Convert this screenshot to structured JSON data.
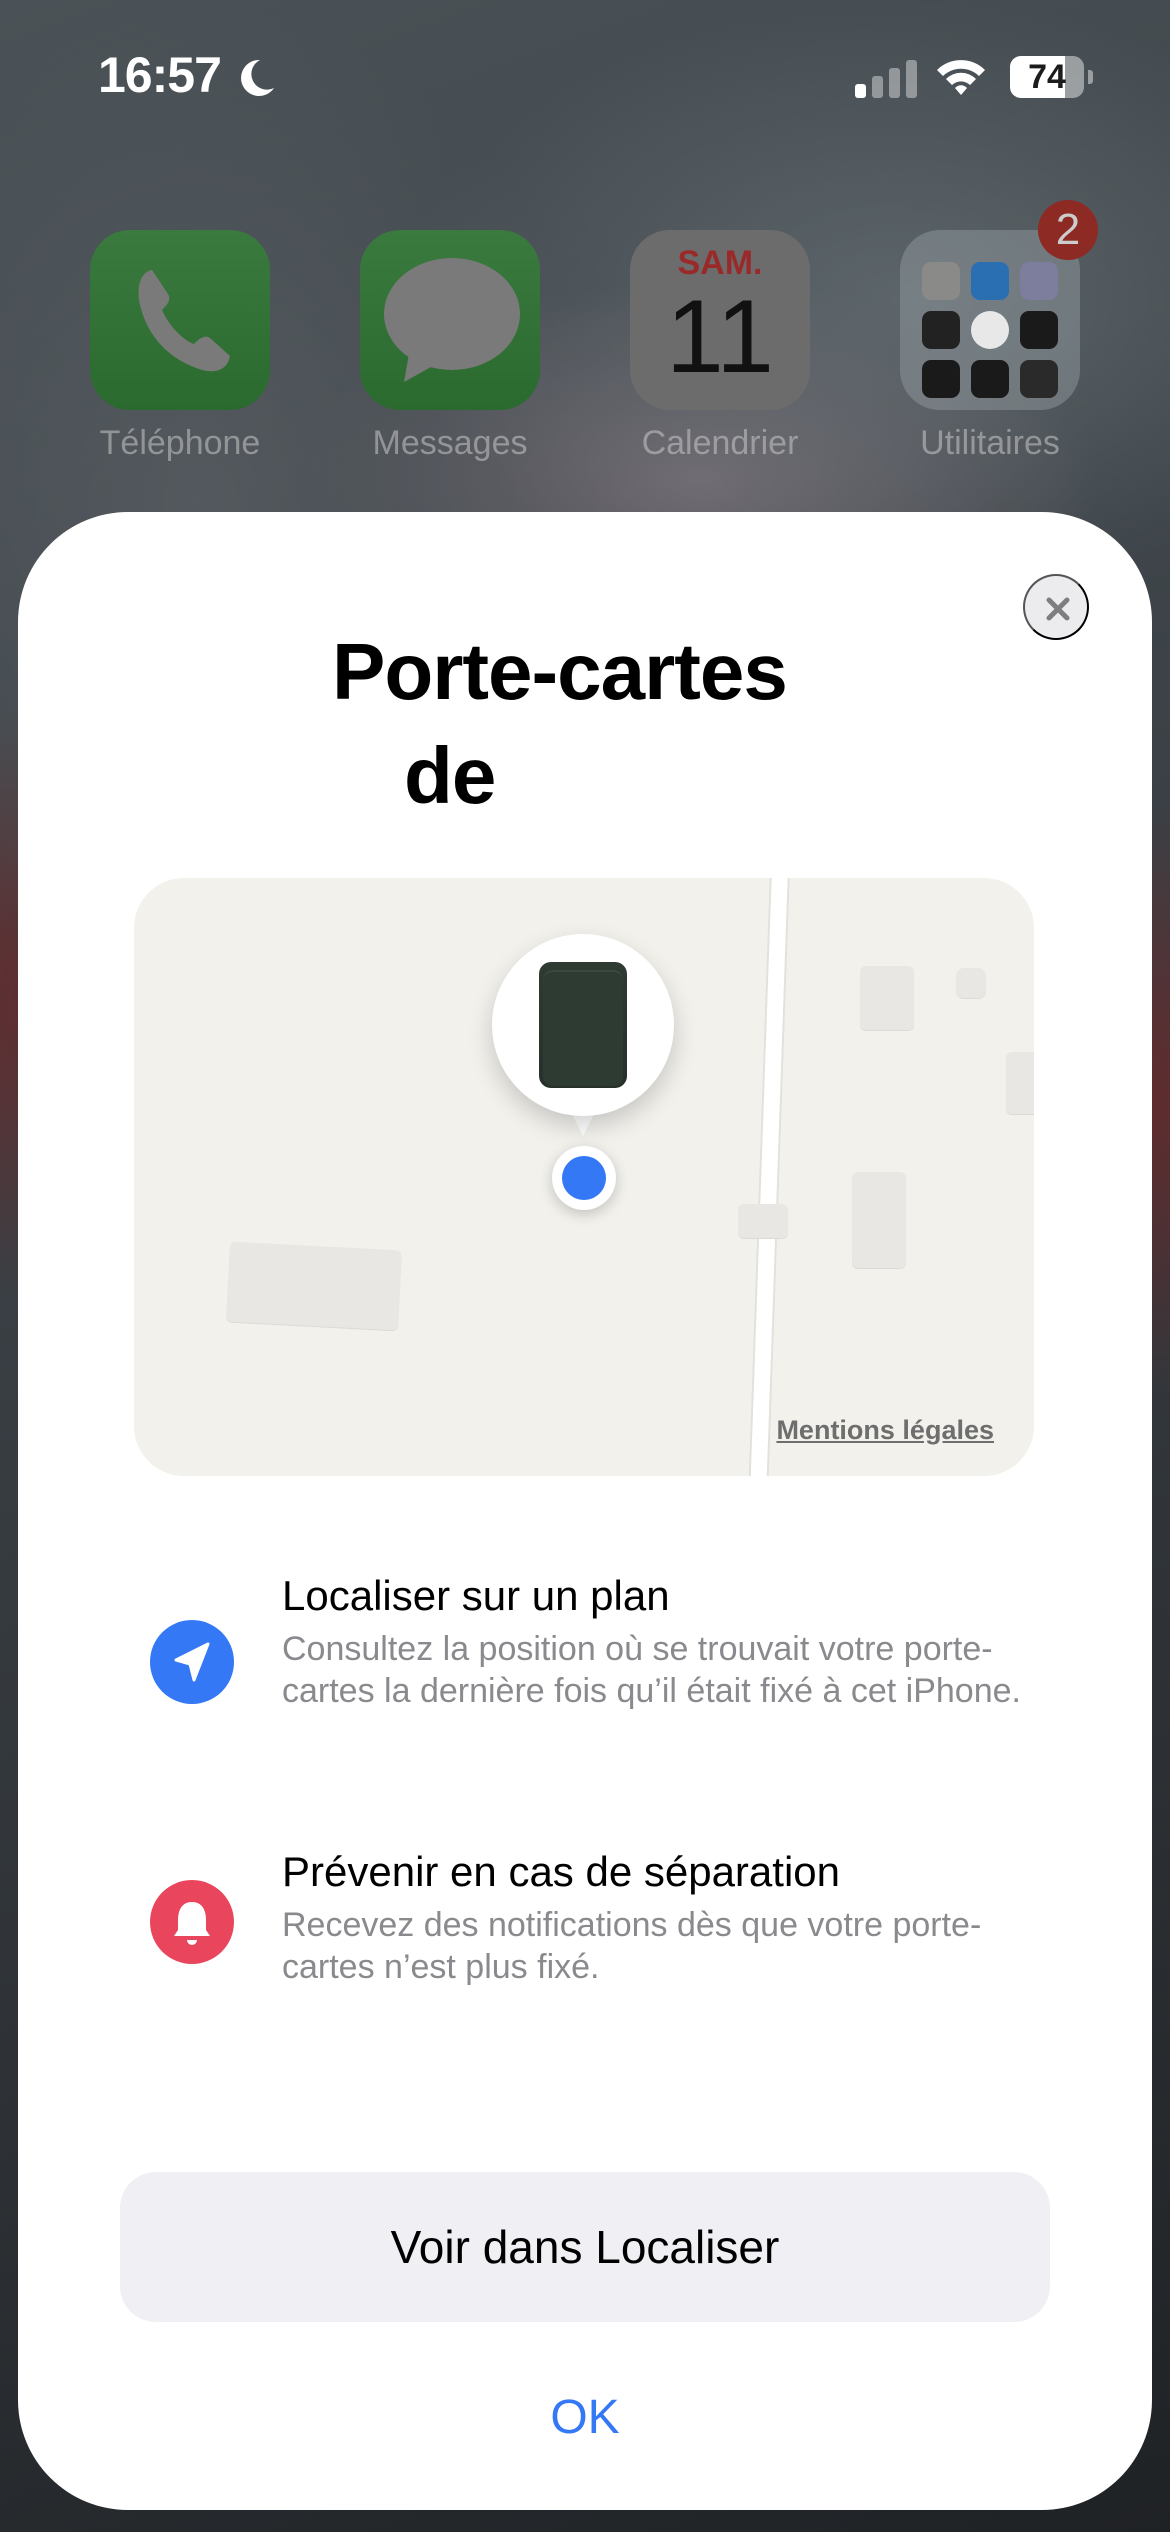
{
  "status_bar": {
    "time": "16:57",
    "focus_icon": "moon-icon",
    "signal_bars_active": 1,
    "signal_bars_total": 4,
    "wifi_icon": "wifi-icon",
    "battery_percent": 74,
    "battery_label": "74"
  },
  "home_screen": {
    "apps": [
      {
        "label": "Téléphone",
        "icon": "phone-icon"
      },
      {
        "label": "Messages",
        "icon": "message-bubble-icon"
      },
      {
        "label": "Calendrier",
        "icon": "calendar-icon",
        "day": "SAM.",
        "date": "11"
      },
      {
        "label": "Utilitaires",
        "icon": "folder-icon",
        "badge": "2"
      }
    ]
  },
  "sheet": {
    "title_line1": "Porte-cartes",
    "title_line2": "de",
    "close_icon": "close-icon",
    "map": {
      "legal_link": "Mentions légales",
      "item_icon": "wallet-icon",
      "location_icon": "location-dot-icon"
    },
    "features": [
      {
        "icon": "location-arrow-icon",
        "icon_color": "#3478f6",
        "title": "Localiser sur un plan",
        "description": "Consultez la position où se trouvait votre porte-cartes la dernière fois qu’il était fixé à cet iPhone."
      },
      {
        "icon": "bell-icon",
        "icon_color": "#e9455d",
        "title": "Prévenir en cas de séparation",
        "description": "Recevez des notifications dès que votre porte-cartes n’est plus fixé."
      }
    ],
    "primary_button": "Voir dans Localiser",
    "secondary_button": "OK"
  },
  "colors": {
    "accent": "#3478f6",
    "alert": "#e9455d",
    "button_bg": "#f0f0f4",
    "map_bg": "#f2f1ec"
  }
}
